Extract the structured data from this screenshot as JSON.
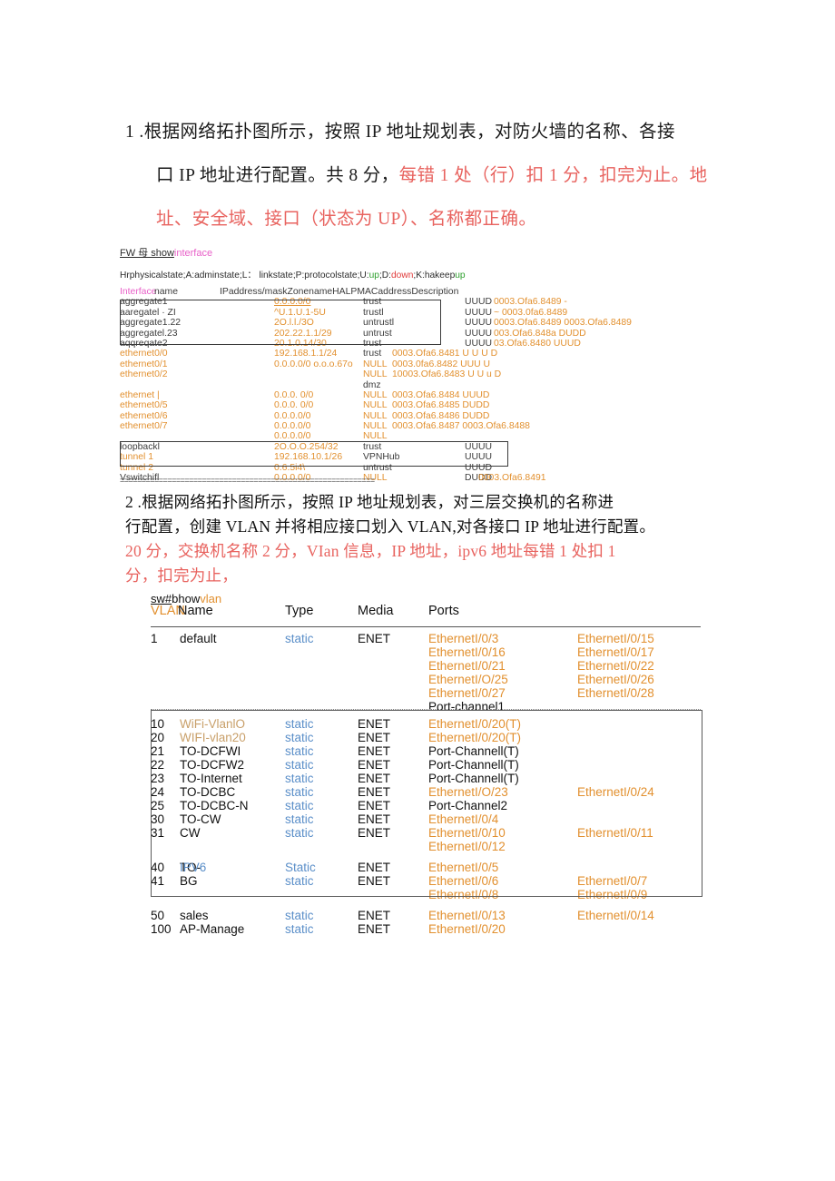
{
  "question1": {
    "number": "1 .",
    "line1_black": "根据网络拓扑图所示，按照 IP 地址规划表，对防火墙的名称、各接",
    "line2_black": "口 IP 地址进行配置。共 8 分，",
    "line2_red": "每错 1 处（行）扣 1 分，扣完为止。地",
    "line3_red": "址、安全域、接口（状态为 UP）、名称都正确。"
  },
  "question2": {
    "number": "2 .",
    "line1": "根据网络拓扑图所示，按照 IP 地址规划表，对三层交换机的名称进",
    "line2": "行配置，创建 VLAN 并将相应接口划入 VLAN,对各接口 IP 地址进行配置。",
    "line3_red": "20 分，交换机名称 2 分，VIan 信息，IP 地址，ipv6 地址每错 1 处扣 1",
    "line4_red": "分，扣完为止，"
  },
  "firewall_output": {
    "prompt_prefix": "FW 母 show",
    "prompt_command": "interface",
    "legend_parts": [
      {
        "text": "Hrphysicalstate;A:adminstate;L：  linkstate;P:protocolstate;U:",
        "color": "#2c2c2c"
      },
      {
        "text": "up",
        "color": "#2ea02e"
      },
      {
        "text": ";D:",
        "color": "#2c2c2c"
      },
      {
        "text": "down",
        "color": "#e03a3a"
      },
      {
        "text": ";K:hakeep",
        "color": "#2c2c2c"
      },
      {
        "text": "up",
        "color": "#2ea02e"
      }
    ],
    "header": {
      "interface_label": "Interface",
      "name_label": " name",
      "rest": "IPaddress/maskZonenameHALPMACaddressDescription"
    },
    "rows": [
      {
        "iface": "aggregate1",
        "ip": "0.0.0.0/0",
        "zone": "trust",
        "hal": "UUUD",
        "mac": "0003.Ofa6.8489 -"
      },
      {
        "iface": "aaregatel · ZI",
        "ip": "^U.1.U.1-5U",
        "zone": "trustl",
        "hal": "UUUU",
        "mac": "~  0003.0fa6.8489"
      },
      {
        "iface": "aggregate1.22",
        "ip": "2O.l.l./3O",
        "zone": "untrustl",
        "hal": "UUUU",
        "mac": "0003.Ofa6.8489 0003.Ofa6.8489"
      },
      {
        "iface": "aggregatel.23",
        "ip": "202.22.1.1/29",
        "zone": "untrust",
        "hal": "UUUU",
        "mac": "003.Ofa6.848a DUDD"
      },
      {
        "iface": "aqqreqate2",
        "ip": "20.1.0.14/30",
        "zone": "trust",
        "hal": "UUUU",
        "mac": "03.Ofa6.8480 UUUD"
      },
      {
        "iface": "ethernet0/0",
        "ip": "192.168.1.1/24",
        "zone": "trust",
        "hal": "",
        "mac": "0003.Ofa6.8481 U  U  U  D"
      },
      {
        "iface": "ethernet0/1",
        "ip": "0.0.0.0/0  o.o.o.67o",
        "zone": "NULL",
        "hal": "",
        "mac": "0003.0fa6.8482 UUU U"
      },
      {
        "iface": "ethernet0/2",
        "ip": "",
        "zone": "NULL",
        "hal": "",
        "mac": "10003.Ofa6.8483 U  U  u D"
      },
      {
        "iface": "",
        "ip": "",
        "zone": "dmz",
        "hal": "",
        "mac": ""
      },
      {
        "iface": "ethernet |",
        "ip": "0.0.0.    0/0",
        "zone": "NULL",
        "hal": "",
        "mac": "0003.Ofa6.8484 UUUD"
      },
      {
        "iface": "ethernet0/5",
        "ip": "0.0.0.    0/0",
        "zone": "NULL",
        "hal": "",
        "mac": "0003.Ofa6.8485 DUDD"
      },
      {
        "iface": "ethernet0/6",
        "ip": "0.0.0.0/0",
        "zone": "NULL",
        "hal": "",
        "mac": "0003.Ofa6.8486 DUDD"
      },
      {
        "iface": "ethernet0/7",
        "ip": "0.0.0.0/0",
        "zone": "NULL",
        "hal": "",
        "mac": "0003.Ofa6.8487 0003.Ofa6.8488"
      },
      {
        "iface": "",
        "ip": "0.0.0.0/0",
        "zone": "NULL",
        "hal": "",
        "mac": ""
      },
      {
        "iface": "loopbackl",
        "ip": "2O.O.O.254/32",
        "zone": "trust",
        "hal": "UUUU",
        "mac": ""
      },
      {
        "iface": "tunnel 1",
        "ip": "192.168.10.1/26",
        "zone": "VPNHub",
        "hal": "UUUU",
        "mac": ""
      },
      {
        "iface": "tunnel 2",
        "ip": "0.6.5i4\\",
        "zone": "untrust",
        "hal": "UUUD",
        "mac": ""
      },
      {
        "iface": "Vswitchifl",
        "ip": "0.0.0.0/0",
        "zone": "NULL",
        "hal": "DUDD",
        "mac": "0003.Ofa6.8491"
      }
    ],
    "separator": "==========================================================="
  },
  "vlan_output": {
    "prompt": "sw#",
    "prompt_cmd_black": "bhow",
    "prompt_cmd_orange": "vlan",
    "columns": {
      "vlan": "VLAN",
      "name": "Name",
      "type": "Type",
      "media": "Media",
      "ports": "Ports"
    },
    "rows": [
      {
        "id": "1",
        "name": "default",
        "name_color": "black",
        "type": "static",
        "type_cap": "static",
        "media": "ENET",
        "ports": [
          {
            "p1": "EthernetI/0/3",
            "p1c": "orange",
            "p2": "EthernetI/0/15",
            "p2c": "orange"
          },
          {
            "p1": "EthernetI/0/16",
            "p1c": "orange",
            "p2": "EthernetI/0/17",
            "p2c": "orange"
          },
          {
            "p1": "EthernetI/0/21",
            "p1c": "orange",
            "p2": "EthernetI/0/22",
            "p2c": "orange"
          },
          {
            "p1": "EthernetI/O/25",
            "p1c": "orange",
            "p2": "EthernetI/0/26",
            "p2c": "orange"
          },
          {
            "p1": "EthernetI/0/27",
            "p1c": "orange",
            "p2": "EthernetI/0/28",
            "p2c": "orange"
          },
          {
            "p1": "Port-channel1",
            "p1c": "black",
            "p2": "",
            "p2c": "black"
          }
        ]
      },
      {
        "id": "10",
        "name": "WiFi-VlanlO",
        "name_color": "tan",
        "type": "static",
        "media": "ENET",
        "ports": [
          {
            "p1": "EthernetI/0/20(T)",
            "p1c": "orange",
            "p2": "",
            "p2c": "black"
          }
        ]
      },
      {
        "id": "20",
        "name": "WIFI-vlan20",
        "name_color": "tan",
        "type": "static",
        "media": "ENET",
        "ports": [
          {
            "p1": "EthernetI/0/20(T)",
            "p1c": "orange",
            "p2": "",
            "p2c": "black"
          }
        ]
      },
      {
        "id": "21",
        "name": "TO-DCFWI",
        "name_color": "black",
        "type": "static",
        "media": "ENET",
        "ports": [
          {
            "p1": "Port-Channell(T)",
            "p1c": "black",
            "p2": "",
            "p2c": "black"
          }
        ]
      },
      {
        "id": "22",
        "name": "TO-DCFW2",
        "name_color": "black",
        "type": "static",
        "media": "ENET",
        "ports": [
          {
            "p1": "Port-Channell(T)",
            "p1c": "black",
            "p2": "",
            "p2c": "black"
          }
        ]
      },
      {
        "id": "23",
        "name": "TO-Internet",
        "name_color": "black",
        "type": "static",
        "media": "ENET",
        "ports": [
          {
            "p1": "Port-Channell(T)",
            "p1c": "black",
            "p2": "",
            "p2c": "black"
          }
        ]
      },
      {
        "id": "24",
        "name": "TO-DCBC",
        "name_color": "black",
        "type": "static",
        "media": "ENET",
        "ports": [
          {
            "p1": "EthernetI/O/23",
            "p1c": "orange",
            "p2": "EthernetI/0/24",
            "p2c": "orange"
          }
        ]
      },
      {
        "id": "25",
        "name": "TO-DCBC-N",
        "name_color": "black",
        "type": "static",
        "media": "ENET",
        "ports": [
          {
            "p1": "Port-Channel2",
            "p1c": "black",
            "p2": "",
            "p2c": "black"
          }
        ]
      },
      {
        "id": "30",
        "name": "TO-CW",
        "name_color": "black",
        "type": "static",
        "media": "ENET",
        "ports": [
          {
            "p1": "EthernetI/0/4",
            "p1c": "orange",
            "p2": "",
            "p2c": "black"
          }
        ]
      },
      {
        "id": "31",
        "name": "CW",
        "name_color": "black",
        "type": "static",
        "media": "ENET",
        "ports": [
          {
            "p1": "EthernetI/0/10",
            "p1c": "orange",
            "p2": "EthernetI/0/11",
            "p2c": "orange"
          },
          {
            "p1": "EthernetI/0/12",
            "p1c": "orange",
            "p2": "",
            "p2c": "black"
          }
        ]
      },
      {
        "id": "40",
        "name": "TO-IPV6",
        "name_color": "split",
        "type": "Static",
        "media": "ENET",
        "ports": [
          {
            "p1": "EthernetI/0/5",
            "p1c": "orange",
            "p2": "",
            "p2c": "black"
          }
        ]
      },
      {
        "id": "41",
        "name": "BG",
        "name_color": "black",
        "type": "static",
        "media": "ENET",
        "ports": [
          {
            "p1": "EthernetI/0/6",
            "p1c": "orange",
            "p2": "EthernetI/0/7",
            "p2c": "orange"
          },
          {
            "p1": "EthernetI/0/8",
            "p1c": "orange",
            "p2": "EthernetI/0/9",
            "p2c": "orange"
          }
        ]
      },
      {
        "id": "50",
        "name": "sales",
        "name_color": "black",
        "type": "static",
        "media": "ENET",
        "ports": [
          {
            "p1": "EthernetI/0/13",
            "p1c": "orange",
            "p2": "EthernetI/0/14",
            "p2c": "orange"
          }
        ]
      },
      {
        "id": "100",
        "name": "AP-Manage",
        "name_color": "black",
        "type": "static",
        "media": "ENET",
        "ports": [
          {
            "p1": "EthernetI/0/20",
            "p1c": "orange",
            "p2": "",
            "p2c": "black"
          }
        ]
      }
    ]
  },
  "colors": {
    "red_annotation": "#e8635f",
    "orange_scan": "#e2902f",
    "blue_scan": "#5b8fc9",
    "tan_scan": "#c9a06a",
    "pink_scan": "#e85fc8"
  }
}
